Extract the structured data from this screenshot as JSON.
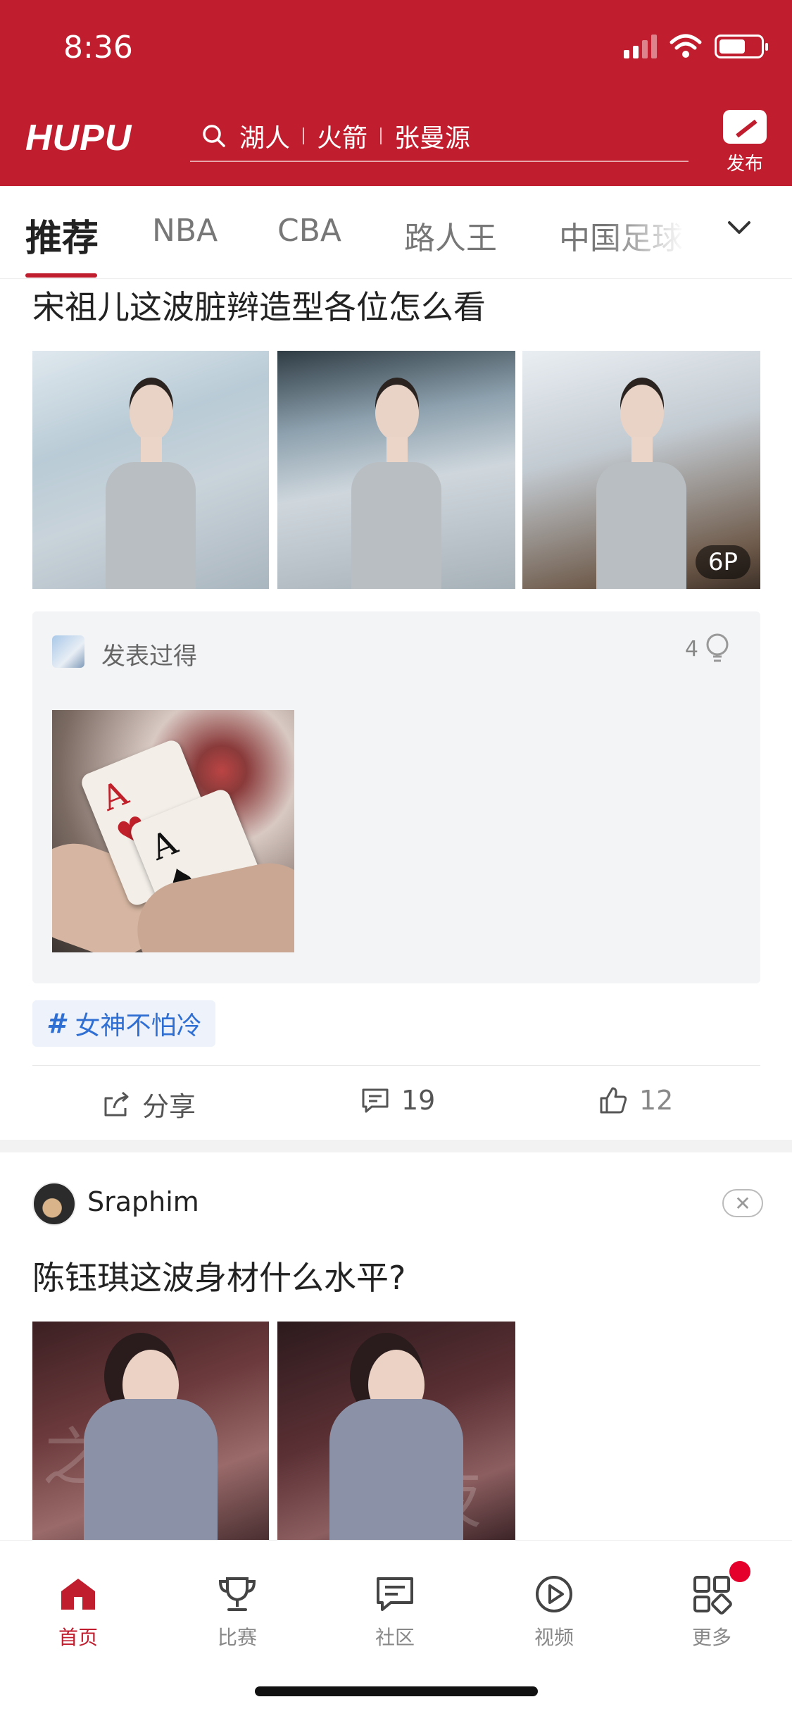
{
  "status_bar": {
    "time": "8:36"
  },
  "header": {
    "logo": "HUPU",
    "search": {
      "terms": [
        "湖人",
        "火箭",
        "张曼源"
      ]
    },
    "publish_label": "发布"
  },
  "tabs": [
    {
      "label": "推荐",
      "active": true
    },
    {
      "label": "NBA"
    },
    {
      "label": "CBA"
    },
    {
      "label": "路人王"
    },
    {
      "label": "中国足球"
    }
  ],
  "post1": {
    "title": "宋祖儿这波脏辫造型各位怎么看",
    "image_count_badge": "6P",
    "quoted_reply": {
      "user": "发表过得",
      "likes": "4"
    },
    "hashtag": "女神不怕冷",
    "actions": {
      "share": "分享",
      "comments": "19",
      "likes": "12"
    }
  },
  "post2": {
    "author": "Sraphim",
    "title": "陈钰琪这波身材什么水平?"
  },
  "bottom_nav": [
    {
      "label": "首页",
      "active": true
    },
    {
      "label": "比赛"
    },
    {
      "label": "社区"
    },
    {
      "label": "视频"
    },
    {
      "label": "更多"
    }
  ],
  "colors": {
    "brand": "#c01e2f",
    "hashtag": "#2f6fd4",
    "notification": "#e4002b"
  }
}
